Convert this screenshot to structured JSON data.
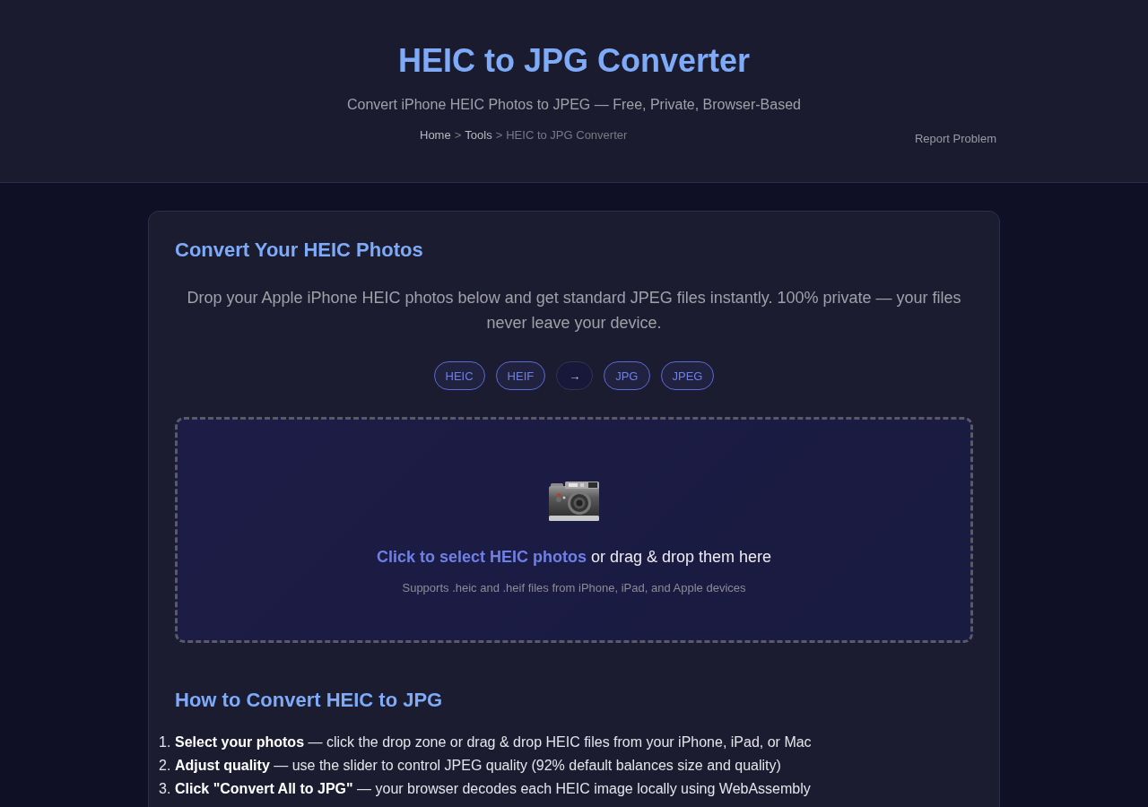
{
  "header": {
    "title": "HEIC to JPG Converter",
    "subtitle": "Convert iPhone HEIC Photos to JPEG — Free, Private, Browser-Based",
    "breadcrumb": [
      {
        "label": "Home",
        "kind": "link"
      },
      {
        "label": ">",
        "kind": "separator"
      },
      {
        "label": "Tools",
        "kind": "link"
      },
      {
        "label": ">",
        "kind": "separator"
      },
      {
        "label": "HEIC to JPG Converter",
        "kind": "current"
      }
    ],
    "report_link": "Report Problem"
  },
  "converter": {
    "title": "Convert Your HEIC Photos",
    "intro": "Drop your Apple iPhone HEIC photos below and get standard JPEG files instantly. 100% private — your files never leave your device.",
    "formats": [
      {
        "label": "HEIC",
        "kind": "format"
      },
      {
        "label": "HEIF",
        "kind": "format"
      },
      {
        "label": "→",
        "kind": "arrow"
      },
      {
        "label": "JPG",
        "kind": "format"
      },
      {
        "label": "JPEG",
        "kind": "format"
      }
    ],
    "drop_zone": {
      "link": "Click to select HEIC photos",
      "text": "or drag & drop them here",
      "hint": "Supports .heic and .heif files from iPhone, iPad, and Apple devices"
    }
  },
  "how_to": {
    "title": "How to Convert HEIC to JPG",
    "steps": [
      {
        "number": "1.",
        "text": "**Select your photos** — click the drop zone or drag & drop HEIC files from your iPhone, iPad, or Mac"
      },
      {
        "number": "2.",
        "text": "**Adjust quality** — use the slider to control JPEG quality (92% default balances size and quality)"
      },
      {
        "number": "3.",
        "text": "**Click \"Convert All to JPG\"** — your browser decodes each HEIC image locally using WebAssembly"
      }
    ]
  }
}
